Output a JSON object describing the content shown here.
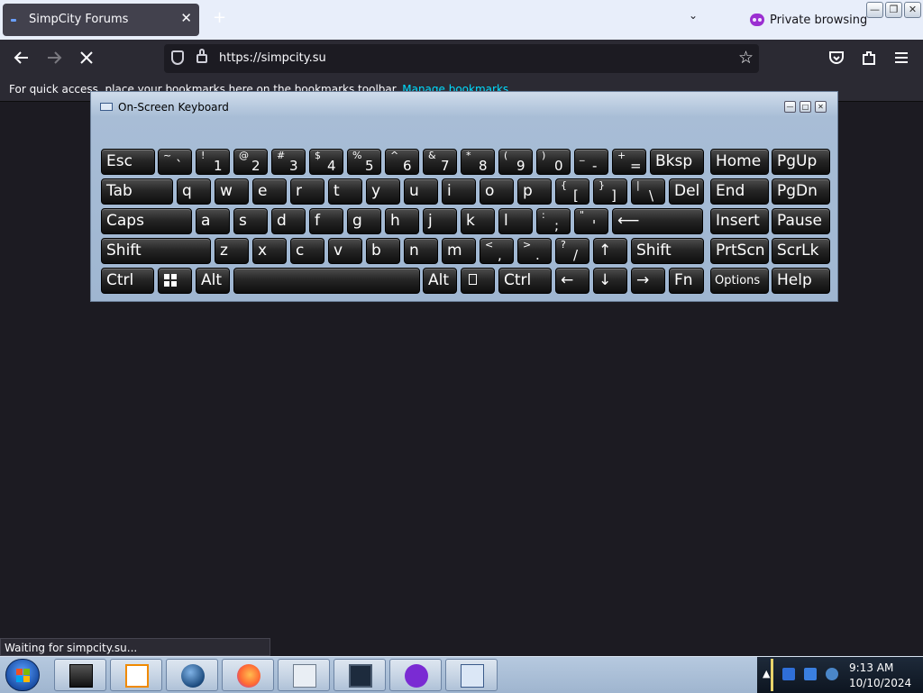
{
  "browser": {
    "tab": {
      "title": "SimpCity Forums",
      "close": "✕"
    },
    "new_tab": "+",
    "tabs_menu": "⌄",
    "private_label": "Private browsing",
    "window_buttons": [
      "—",
      "❐",
      "✕"
    ],
    "url": "https://simpcity.su",
    "bookmarks_text": "For quick access, place your bookmarks here on the bookmarks toolbar.",
    "bookmarks_link": "Manage bookmarks…",
    "status": "Waiting for simpcity.su...",
    "icons": [
      "back-arrow-icon",
      "forward-arrow-icon",
      "stop-icon",
      "shield-icon",
      "lock-icon",
      "star-icon",
      "pocket-icon",
      "extensions-icon",
      "menu-icon"
    ]
  },
  "osk": {
    "title": "On-Screen Keyboard",
    "rows": [
      [
        {
          "main": "Esc"
        },
        {
          "top": "~",
          "bot": "`"
        },
        {
          "top": "!",
          "bot": "1"
        },
        {
          "top": "@",
          "bot": "2"
        },
        {
          "top": "#",
          "bot": "3"
        },
        {
          "top": "$",
          "bot": "4"
        },
        {
          "top": "%",
          "bot": "5"
        },
        {
          "top": "^",
          "bot": "6"
        },
        {
          "top": "&",
          "bot": "7"
        },
        {
          "top": "*",
          "bot": "8"
        },
        {
          "top": "(",
          "bot": "9"
        },
        {
          "top": ")",
          "bot": "0"
        },
        {
          "top": "_",
          "bot": "-"
        },
        {
          "top": "+",
          "bot": "="
        },
        {
          "main": "Bksp"
        },
        {
          "main": "Home"
        },
        {
          "main": "PgUp"
        }
      ],
      [
        {
          "main": "Tab"
        },
        {
          "main": "q"
        },
        {
          "main": "w"
        },
        {
          "main": "e"
        },
        {
          "main": "r"
        },
        {
          "main": "t"
        },
        {
          "main": "y"
        },
        {
          "main": "u"
        },
        {
          "main": "i"
        },
        {
          "main": "o"
        },
        {
          "main": "p"
        },
        {
          "top": "{",
          "bot": "["
        },
        {
          "top": "}",
          "bot": "]"
        },
        {
          "top": "|",
          "bot": "\\"
        },
        {
          "main": "Del"
        },
        {
          "main": "End"
        },
        {
          "main": "PgDn"
        }
      ],
      [
        {
          "main": "Caps"
        },
        {
          "main": "a"
        },
        {
          "main": "s"
        },
        {
          "main": "d"
        },
        {
          "main": "f"
        },
        {
          "main": "g"
        },
        {
          "main": "h"
        },
        {
          "main": "j"
        },
        {
          "main": "k"
        },
        {
          "main": "l"
        },
        {
          "top": ":",
          "bot": ";"
        },
        {
          "top": "\"",
          "bot": "'"
        },
        {
          "main": "⟵"
        },
        {
          "main": "Insert"
        },
        {
          "main": "Pause"
        }
      ],
      [
        {
          "main": "Shift"
        },
        {
          "main": "z"
        },
        {
          "main": "x"
        },
        {
          "main": "c"
        },
        {
          "main": "v"
        },
        {
          "main": "b"
        },
        {
          "main": "n"
        },
        {
          "main": "m"
        },
        {
          "top": "<",
          "bot": ","
        },
        {
          "top": ">",
          "bot": "."
        },
        {
          "top": "?",
          "bot": "/"
        },
        {
          "main": "↑"
        },
        {
          "main": "Shift"
        },
        {
          "main": "PrtScn"
        },
        {
          "main": "ScrLk"
        }
      ],
      [
        {
          "main": "Ctrl"
        },
        {
          "icon": "windows-logo-icon"
        },
        {
          "main": "Alt"
        },
        {
          "main": ""
        },
        {
          "main": "Alt"
        },
        {
          "icon": "context-menu-icon"
        },
        {
          "main": "Ctrl"
        },
        {
          "main": "←"
        },
        {
          "main": "↓"
        },
        {
          "main": "→"
        },
        {
          "main": "Fn"
        },
        {
          "small": "Options"
        },
        {
          "main": "Help"
        }
      ]
    ]
  },
  "taskbar": {
    "apps": [
      "media-player-icon",
      "vlc-icon",
      "globe-icon",
      "firefox-icon",
      "calculator-icon",
      "monitor-icon",
      "private-browsing-icon",
      "on-screen-keyboard-icon"
    ],
    "time": "9:13 AM",
    "date": "10/10/2024"
  }
}
